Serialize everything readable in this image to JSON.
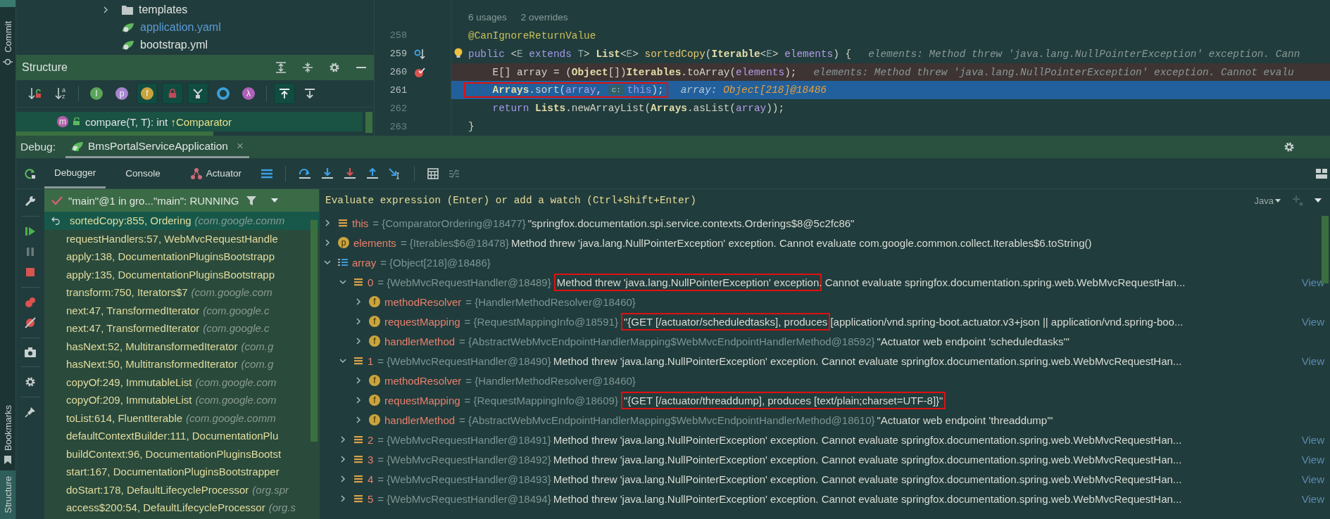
{
  "side_strip": {
    "top_label": "Commit",
    "bottom_tabs": [
      {
        "label": "Bookmarks",
        "selected": false
      },
      {
        "label": "Structure",
        "selected": true
      }
    ]
  },
  "project_tree": {
    "items": [
      {
        "kind": "folder",
        "label": "templates",
        "modified": false
      },
      {
        "kind": "yaml",
        "label": "application.yaml",
        "modified": true
      },
      {
        "kind": "yaml",
        "label": "bootstrap.yml",
        "modified": false
      }
    ]
  },
  "structure": {
    "title": "Structure",
    "tools": [
      {
        "kind": "sort-visibility",
        "selected": false
      },
      {
        "kind": "sort-alpha",
        "glyph": "az",
        "selected": false
      },
      {
        "kind": "badge",
        "glyph": "I",
        "color": "#5aa55a",
        "selected": false
      },
      {
        "kind": "badge",
        "glyph": "p",
        "color": "#a585d0",
        "selected": false
      },
      {
        "kind": "badge",
        "glyph": "f",
        "color": "#c9a43e",
        "selected": true
      },
      {
        "kind": "lock",
        "selected": true
      },
      {
        "kind": "hierarchy",
        "selected": true
      },
      {
        "kind": "ring",
        "color": "#3aa0d8",
        "selected": false
      },
      {
        "kind": "badge",
        "glyph": "λ",
        "color": "#b061b8",
        "selected": false
      },
      {
        "kind": "expand",
        "selected": true
      },
      {
        "kind": "collapse",
        "selected": false
      }
    ],
    "item": {
      "badge": "m",
      "label": "compare(T, T): int ",
      "origin": "↑Comparator",
      "selected": true
    }
  },
  "editor": {
    "usage_hints": [
      "6 usages",
      "2 overrides"
    ],
    "lines": [
      {
        "number": "258",
        "kind": "normal",
        "overrides": false,
        "bulb": false,
        "boxed": false,
        "tokens": [
          {
            "t": "@CanIgnoreReturnValue",
            "kind": "anno"
          }
        ]
      },
      {
        "number": "259",
        "kind": "normal",
        "overrides": true,
        "bulb": true,
        "boxed": false,
        "tokens": [
          {
            "t": "public ",
            "kind": "kw"
          },
          {
            "t": "<",
            "kind": "plain"
          },
          {
            "t": "E",
            "kind": "type"
          },
          {
            "t": " extends ",
            "kind": "kw"
          },
          {
            "t": "T",
            "kind": "type"
          },
          {
            "t": "> ",
            "kind": "plain"
          },
          {
            "t": "List",
            "kind": "cls"
          },
          {
            "t": "<",
            "kind": "plain"
          },
          {
            "t": "E",
            "kind": "type"
          },
          {
            "t": "> ",
            "kind": "plain"
          },
          {
            "t": "sortedCopy",
            "kind": "fn"
          },
          {
            "t": "(",
            "kind": "plain"
          },
          {
            "t": "Iterable",
            "kind": "cls"
          },
          {
            "t": "<",
            "kind": "plain"
          },
          {
            "t": "E",
            "kind": "type"
          },
          {
            "t": "> ",
            "kind": "plain"
          },
          {
            "t": "elements",
            "kind": "param"
          },
          {
            "t": ") {",
            "kind": "plain"
          },
          {
            "t": "elements: Method threw 'java.lang.NullPointerException' exception. Cann",
            "kind": "hint"
          }
        ]
      },
      {
        "number": "260",
        "kind": "breakpoint",
        "overrides": false,
        "bulb": false,
        "boxed": false,
        "tokens": [
          {
            "t": "    E[] ",
            "kind": "plain"
          },
          {
            "t": "array",
            "kind": "plain"
          },
          {
            "t": " = (",
            "kind": "plain"
          },
          {
            "t": "Object",
            "kind": "cls"
          },
          {
            "t": "[])",
            "kind": "plain"
          },
          {
            "t": "Iterables",
            "kind": "cls"
          },
          {
            "t": ".toArray(",
            "kind": "plain"
          },
          {
            "t": "elements",
            "kind": "param"
          },
          {
            "t": ");",
            "kind": "plain"
          },
          {
            "t": "elements: Method threw 'java.lang.NullPointerException' exception. Cannot evalu",
            "kind": "hint"
          }
        ]
      },
      {
        "number": "261",
        "kind": "execution",
        "overrides": false,
        "bulb": false,
        "boxed": true,
        "tokens": [
          {
            "t": "    Arrays",
            "kind": "cls"
          },
          {
            "t": ".sort(",
            "kind": "plain"
          },
          {
            "t": "array",
            "kind": "param"
          },
          {
            "t": ", ",
            "kind": "plain"
          },
          {
            "t": "c:",
            "kind": "chip"
          },
          {
            "t": "this",
            "kind": "kw"
          },
          {
            "t": ");",
            "kind": "plain"
          },
          {
            "t": "array: ",
            "kind": "hint"
          },
          {
            "t": "Object[218]@18486",
            "kind": "hintval"
          }
        ]
      },
      {
        "number": "262",
        "kind": "normal",
        "overrides": false,
        "bulb": false,
        "boxed": false,
        "tokens": [
          {
            "t": "    return ",
            "kind": "kw"
          },
          {
            "t": "Lists",
            "kind": "cls"
          },
          {
            "t": ".newArrayList(",
            "kind": "plain"
          },
          {
            "t": "Arrays",
            "kind": "cls"
          },
          {
            "t": ".asList(",
            "kind": "plain"
          },
          {
            "t": "array",
            "kind": "param"
          },
          {
            "t": "));",
            "kind": "plain"
          }
        ]
      },
      {
        "number": "263",
        "kind": "normal",
        "overrides": false,
        "bulb": false,
        "boxed": false,
        "tokens": [
          {
            "t": "}",
            "kind": "plain"
          }
        ]
      }
    ]
  },
  "debug": {
    "label": "Debug:",
    "session": {
      "label": "BmsPortalServiceApplication",
      "close": "×",
      "selected": true
    },
    "tabs": [
      {
        "label": "Debugger",
        "kind": "plain",
        "selected": true
      },
      {
        "label": "Console",
        "kind": "plain",
        "selected": false
      },
      {
        "label": "Actuator",
        "kind": "actuator",
        "selected": false
      }
    ],
    "thread": {
      "label": "\"main\"@1 in gro...\"main\": RUNNING"
    },
    "watch_placeholder": "Evaluate expression (Enter) or add a watch (Ctrl+Shift+Enter)",
    "language": "Java",
    "frames": [
      {
        "method": "sortedCopy:855, Ordering",
        "package": "(com.google.comm",
        "selected": true
      },
      {
        "method": "requestHandlers:57, WebMvcRequestHandle",
        "selected": false
      },
      {
        "method": "apply:138, DocumentationPluginsBootstrapp",
        "selected": false
      },
      {
        "method": "apply:135, DocumentationPluginsBootstrapp",
        "selected": false
      },
      {
        "method": "transform:750, Iterators$7",
        "package": "(com.google.com",
        "selected": false
      },
      {
        "method": "next:47, TransformedIterator",
        "package": "(com.google.c",
        "selected": false
      },
      {
        "method": "next:47, TransformedIterator",
        "package": "(com.google.c",
        "selected": false
      },
      {
        "method": "hasNext:52, MultitransformedIterator",
        "package": "(com.g",
        "selected": false
      },
      {
        "method": "hasNext:50, MultitransformedIterator",
        "package": "(com.g",
        "selected": false
      },
      {
        "method": "copyOf:249, ImmutableList",
        "package": "(com.google.com",
        "selected": false
      },
      {
        "method": "copyOf:209, ImmutableList",
        "package": "(com.google.com",
        "selected": false
      },
      {
        "method": "toList:614, FluentIterable",
        "package": "(com.google.comm",
        "selected": false
      },
      {
        "method": "defaultContextBuilder:111, DocumentationPlu",
        "selected": false
      },
      {
        "method": "buildContext:96, DocumentationPluginsBootst",
        "selected": false
      },
      {
        "method": "start:167, DocumentationPluginsBootstrapper",
        "selected": false
      },
      {
        "method": "doStart:178, DefaultLifecycleProcessor",
        "package": "(org.spr",
        "selected": false
      },
      {
        "method": "access$200:54, DefaultLifecycleProcessor",
        "package": "(org.s",
        "selected": false
      }
    ],
    "variables": [
      {
        "kind": "list",
        "name": "this",
        "ref": "= {ComparatorOrdering@18477}",
        "value": "\"springfox.documentation.spi.service.contexts.Orderings$8@5c2fc86\"",
        "expanded": false
      },
      {
        "kind": "field",
        "badge": "p",
        "name": "elements",
        "ref": "= {Iterables$6@18478}",
        "value": "Method threw 'java.lang.NullPointerException' exception. Cannot evaluate com.google.common.collect.Iterables$6.toString()",
        "expanded": false
      },
      {
        "kind": "array",
        "name": "array",
        "ref": "= {Object[218]@18486}",
        "expanded": true,
        "children": [
          {
            "kind": "list",
            "name": "0",
            "ref": "= {WebMvcRequestHandler@18489}",
            "boxed_value": "Method threw 'java.lang.NullPointerException' exception",
            "value": ". Cannot evaluate springfox.documentation.spring.web.WebMvcRequestHan...",
            "link": "View",
            "expanded": true,
            "children": [
              {
                "kind": "field",
                "badge": "f",
                "name": "methodResolver",
                "ref": "= {HandlerMethodResolver@18460}",
                "expanded": false
              },
              {
                "kind": "field",
                "badge": "f",
                "name": "requestMapping",
                "ref": "= {RequestMappingInfo@18591}",
                "boxed_value": "\"{GET [/actuator/scheduledtasks], produces",
                "value": " [application/vnd.spring-boot.actuator.v3+json || application/vnd.spring-boo...",
                "link": "View",
                "expanded": false
              },
              {
                "kind": "field",
                "badge": "f",
                "name": "handlerMethod",
                "ref": "= {AbstractWebMvcEndpointHandlerMapping$WebMvcEndpointHandlerMethod@18592}",
                "value": "\"Actuator web endpoint 'scheduledtasks'\"",
                "expanded": false
              }
            ]
          },
          {
            "kind": "list",
            "name": "1",
            "ref": "= {WebMvcRequestHandler@18490}",
            "value": "Method threw 'java.lang.NullPointerException' exception. Cannot evaluate springfox.documentation.spring.web.WebMvcRequestHan...",
            "link": "View",
            "expanded": true,
            "children": [
              {
                "kind": "field",
                "badge": "f",
                "name": "methodResolver",
                "ref": "= {HandlerMethodResolver@18460}",
                "expanded": false
              },
              {
                "kind": "field",
                "badge": "f",
                "name": "requestMapping",
                "ref": "= {RequestMappingInfo@18609}",
                "boxed_value": "\"{GET [/actuator/threaddump], produces [text/plain;charset=UTF-8]}\"",
                "expanded": false
              },
              {
                "kind": "field",
                "badge": "f",
                "name": "handlerMethod",
                "ref": "= {AbstractWebMvcEndpointHandlerMapping$WebMvcEndpointHandlerMethod@18610}",
                "value": "\"Actuator web endpoint 'threaddump'\"",
                "expanded": false
              }
            ]
          },
          {
            "kind": "list",
            "name": "2",
            "ref": "= {WebMvcRequestHandler@18491}",
            "value": "Method threw 'java.lang.NullPointerException' exception. Cannot evaluate springfox.documentation.spring.web.WebMvcRequestHan...",
            "link": "View",
            "expanded": false
          },
          {
            "kind": "list",
            "name": "3",
            "ref": "= {WebMvcRequestHandler@18492}",
            "value": "Method threw 'java.lang.NullPointerException' exception. Cannot evaluate springfox.documentation.spring.web.WebMvcRequestHan...",
            "link": "View",
            "expanded": false
          },
          {
            "kind": "list",
            "name": "4",
            "ref": "= {WebMvcRequestHandler@18493}",
            "value": "Method threw 'java.lang.NullPointerException' exception. Cannot evaluate springfox.documentation.spring.web.WebMvcRequestHan...",
            "link": "View",
            "expanded": false
          },
          {
            "kind": "list",
            "name": "5",
            "ref": "= {WebMvcRequestHandler@18494}",
            "value": "Method threw 'java.lang.NullPointerException' exception. Cannot evaluate springfox.documentation.spring.web.WebMvcRequestHan...",
            "link": "View",
            "expanded": false
          }
        ]
      }
    ]
  }
}
